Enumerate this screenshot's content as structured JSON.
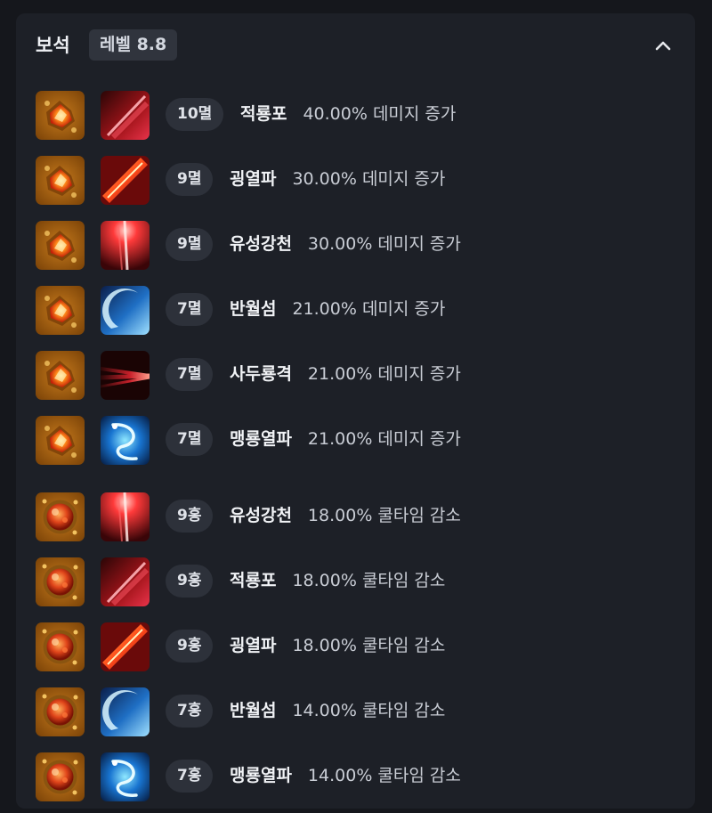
{
  "section": {
    "title": "보석",
    "level_badge": "레벨 8.8",
    "collapse_icon": "chevron-up-icon"
  },
  "gems": [
    {
      "tier": "10멸",
      "skill": "적룡포",
      "effect": "40.00% 데미지 증가",
      "gem_type": "damage",
      "skill_icon": "red-spear-icon"
    },
    {
      "tier": "9멸",
      "skill": "굉열파",
      "effect": "30.00% 데미지 증가",
      "gem_type": "damage",
      "skill_icon": "red-slash-icon"
    },
    {
      "tier": "9멸",
      "skill": "유성강천",
      "effect": "30.00% 데미지 증가",
      "gem_type": "damage",
      "skill_icon": "meteor-icon"
    },
    {
      "tier": "7멸",
      "skill": "반월섬",
      "effect": "21.00% 데미지 증가",
      "gem_type": "damage",
      "skill_icon": "blue-crescent-icon"
    },
    {
      "tier": "7멸",
      "skill": "사두룡격",
      "effect": "21.00% 데미지 증가",
      "gem_type": "damage",
      "skill_icon": "red-thrust-icon"
    },
    {
      "tier": "7멸",
      "skill": "맹룡열파",
      "effect": "21.00% 데미지 증가",
      "gem_type": "damage",
      "skill_icon": "blue-dragon-icon"
    },
    {
      "tier": "9홍",
      "skill": "유성강천",
      "effect": "18.00% 쿨타임 감소",
      "gem_type": "cooldown",
      "skill_icon": "meteor-icon"
    },
    {
      "tier": "9홍",
      "skill": "적룡포",
      "effect": "18.00% 쿨타임 감소",
      "gem_type": "cooldown",
      "skill_icon": "red-spear-icon"
    },
    {
      "tier": "9홍",
      "skill": "굉열파",
      "effect": "18.00% 쿨타임 감소",
      "gem_type": "cooldown",
      "skill_icon": "red-slash-icon"
    },
    {
      "tier": "7홍",
      "skill": "반월섬",
      "effect": "14.00% 쿨타임 감소",
      "gem_type": "cooldown",
      "skill_icon": "blue-crescent-icon"
    },
    {
      "tier": "7홍",
      "skill": "맹룡열파",
      "effect": "14.00% 쿨타임 감소",
      "gem_type": "cooldown",
      "skill_icon": "blue-dragon-icon"
    }
  ],
  "colors": {
    "background": "#15171c",
    "panel": "#1d2027",
    "badge": "#2d313a",
    "gem_frame": "#b0721a",
    "text_primary": "#f1f3f6",
    "text_secondary": "#c9cdd5"
  }
}
